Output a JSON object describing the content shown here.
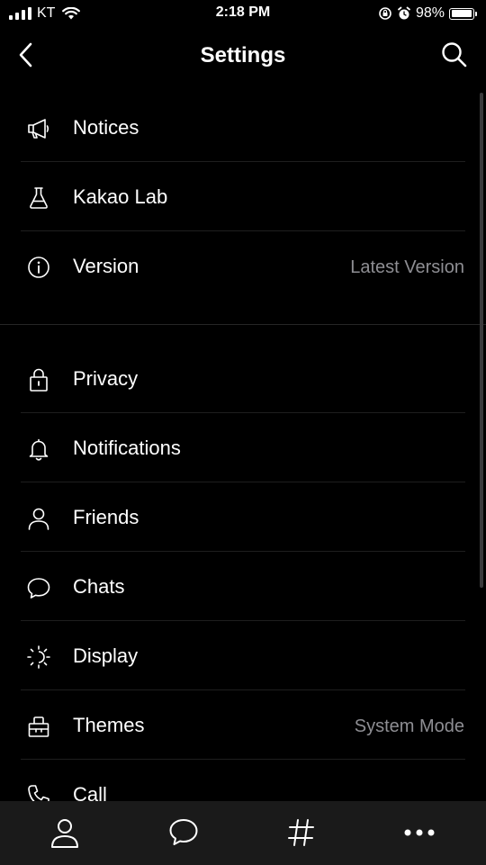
{
  "status_bar": {
    "carrier": "KT",
    "time": "2:18 PM",
    "battery": "98%",
    "battery_level": 0.98
  },
  "nav": {
    "title": "Settings",
    "back_icon": "chevron-left-icon",
    "search_icon": "search-icon"
  },
  "sections": [
    {
      "items": [
        {
          "icon": "megaphone-icon",
          "label": "Notices",
          "value": ""
        },
        {
          "icon": "flask-icon",
          "label": "Kakao Lab",
          "value": ""
        },
        {
          "icon": "info-icon",
          "label": "Version",
          "value": "Latest Version"
        }
      ]
    },
    {
      "items": [
        {
          "icon": "lock-icon",
          "label": "Privacy",
          "value": ""
        },
        {
          "icon": "bell-icon",
          "label": "Notifications",
          "value": ""
        },
        {
          "icon": "person-icon",
          "label": "Friends",
          "value": ""
        },
        {
          "icon": "chat-bubble-icon",
          "label": "Chats",
          "value": ""
        },
        {
          "icon": "brightness-icon",
          "label": "Display",
          "value": ""
        },
        {
          "icon": "palette-icon",
          "label": "Themes",
          "value": "System Mode"
        },
        {
          "icon": "phone-icon",
          "label": "Call",
          "value": ""
        }
      ]
    }
  ],
  "tab_bar": {
    "tabs": [
      {
        "icon": "person-icon",
        "name": "friends"
      },
      {
        "icon": "chat-bubble-icon",
        "name": "chats"
      },
      {
        "icon": "hashtag-icon",
        "name": "view"
      },
      {
        "icon": "more-icon",
        "name": "more"
      }
    ]
  },
  "colors": {
    "background": "#000000",
    "text": "#ffffff",
    "secondary_text": "#8e8e93",
    "separator": "#1e1e1e",
    "tab_bar": "#1a1a1a"
  }
}
